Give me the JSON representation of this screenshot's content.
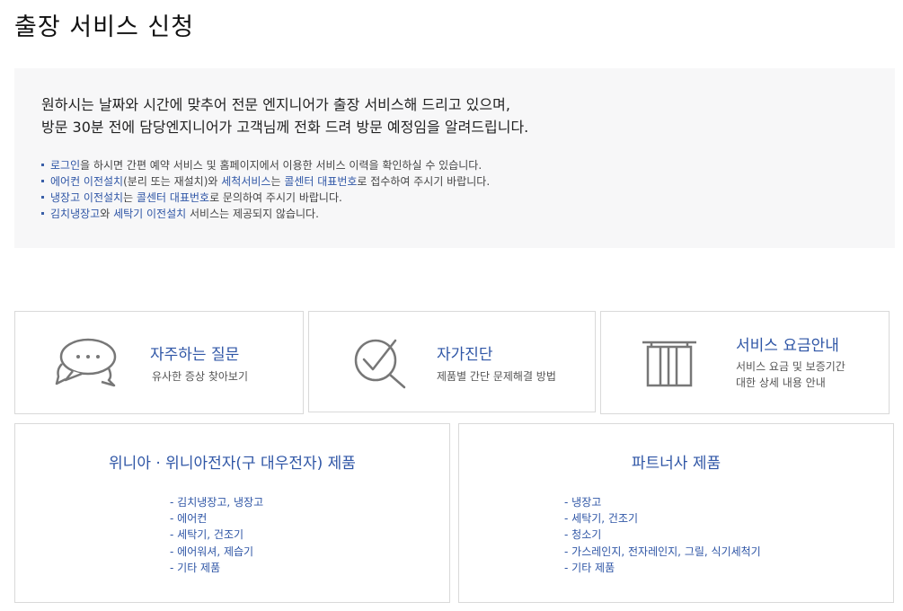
{
  "page": {
    "title": "출장 서비스 신청"
  },
  "notice": {
    "lead_line1": "원하시는 날짜와 시간에 맞추어 전문 엔지니어가 출장 서비스해 드리고 있으며,",
    "lead_line2": "방문 30분 전에 담당엔지니어가 고객님께 전화 드려 방문 예정임을 알려드립니다.",
    "items": [
      {
        "parts": [
          {
            "text": "로그인",
            "hl": true
          },
          {
            "text": "을 하시면 간편 예약 서비스 및 홈페이지에서 이용한 서비스 이력을 확인하실 수 있습니다.",
            "hl": false
          }
        ]
      },
      {
        "parts": [
          {
            "text": "에어컨 이전설치",
            "hl": true
          },
          {
            "text": "(분리 또는 재설치)와 ",
            "hl": false
          },
          {
            "text": "세척서비스",
            "hl": true
          },
          {
            "text": "는 ",
            "hl": false
          },
          {
            "text": "콜센터 대표번호",
            "hl": true
          },
          {
            "text": "로 접수하여 주시기 바랍니다.",
            "hl": false
          }
        ]
      },
      {
        "parts": [
          {
            "text": "냉장고 이전설치",
            "hl": true
          },
          {
            "text": "는 ",
            "hl": false
          },
          {
            "text": "콜센터 대표번호",
            "hl": true
          },
          {
            "text": "로 문의하여 주시기 바랍니다.",
            "hl": false
          }
        ]
      },
      {
        "parts": [
          {
            "text": "김치냉장고",
            "hl": true
          },
          {
            "text": "와 ",
            "hl": false
          },
          {
            "text": "세탁기 이전설치",
            "hl": true
          },
          {
            "text": " 서비스는 제공되지 않습니다.",
            "hl": false
          }
        ]
      }
    ]
  },
  "quick_links": {
    "faq": {
      "title": "자주하는 질문",
      "desc": "유사한 증상 찾아보기",
      "icon": "speech-bubble-icon"
    },
    "self_diagnosis": {
      "title": "자가진단",
      "desc": "제품별 간단 문제해결 방법",
      "icon": "magnifier-check-icon"
    },
    "fee_guide": {
      "title": "서비스 요금안내",
      "desc_line1": "서비스 요금 및 보증기간",
      "desc_line2": "대한 상세 내용 안내",
      "icon": "receipt-icon"
    }
  },
  "products": {
    "winia": {
      "title": "위니아 · 위니아전자(구 대우전자) 제품",
      "items": [
        "김치냉장고, 냉장고",
        "에어컨",
        "세탁기, 건조기",
        "에어워셔, 제습기",
        "기타 제품"
      ]
    },
    "partner": {
      "title": "파트너사 제품",
      "items": [
        "냉장고",
        "세탁기, 건조기",
        "청소기",
        "가스레인지, 전자레인지, 그릴, 식기세척기",
        "기타 제품"
      ]
    }
  },
  "colors": {
    "accent": "#2f56a6",
    "notice_bg": "#f7f7f8",
    "border": "#d9d9d9",
    "icon": "#777777"
  }
}
